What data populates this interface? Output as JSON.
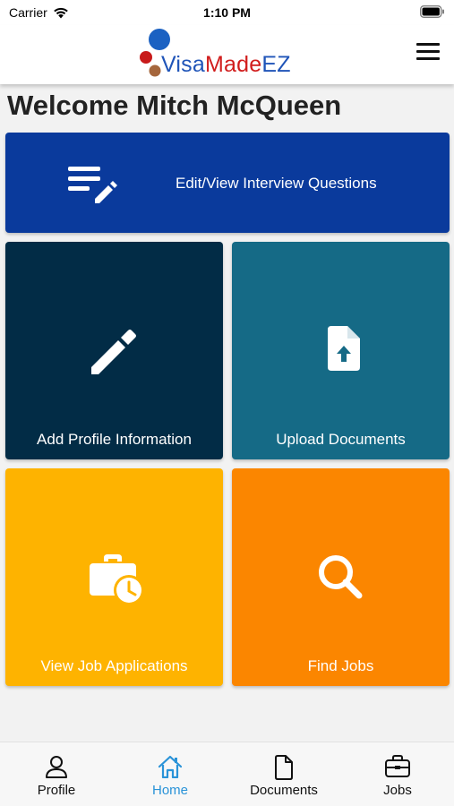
{
  "status_bar": {
    "carrier": "Carrier",
    "time": "1:10 PM"
  },
  "header": {
    "logo": {
      "part1": "Visa",
      "part2": "Made",
      "part3": "EZ"
    },
    "menu_icon": "hamburger-menu-icon"
  },
  "welcome_text": "Welcome Mitch McQueen",
  "tiles": [
    {
      "label": "Edit/View Interview Questions",
      "icon": "edit-list-icon",
      "color": "#0a3a9c"
    },
    {
      "label": "Add Profile Information",
      "icon": "pencil-icon",
      "color": "#022c46"
    },
    {
      "label": "Upload Documents",
      "icon": "file-upload-icon",
      "color": "#156a86"
    },
    {
      "label": "View Job Applications",
      "icon": "briefcase-clock-icon",
      "color": "#feb300"
    },
    {
      "label": "Find Jobs",
      "icon": "search-icon",
      "color": "#fb8600"
    }
  ],
  "tab_bar": {
    "active_color": "#2a93d8",
    "tabs": [
      {
        "label": "Profile",
        "icon": "person-icon"
      },
      {
        "label": "Home",
        "icon": "home-icon",
        "active": true
      },
      {
        "label": "Documents",
        "icon": "document-icon"
      },
      {
        "label": "Jobs",
        "icon": "briefcase-icon"
      }
    ]
  }
}
